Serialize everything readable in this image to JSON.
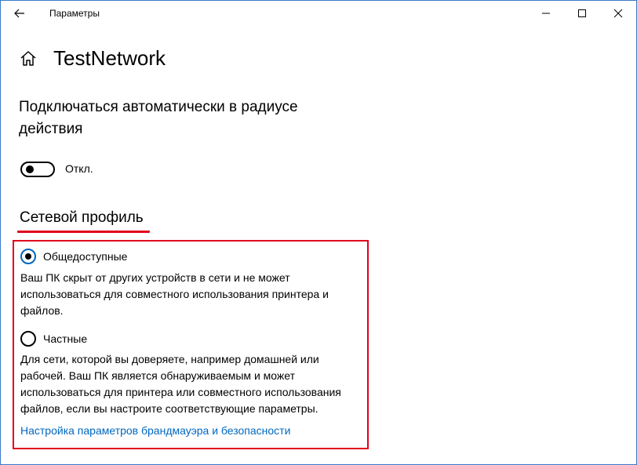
{
  "window": {
    "title": "Параметры"
  },
  "icons": {
    "back": "back-arrow-icon",
    "minimize": "minimize-icon",
    "maximize": "maximize-icon",
    "close": "close-icon",
    "home": "home-icon"
  },
  "page": {
    "title": "TestNetwork"
  },
  "auto_connect": {
    "heading": "Подключаться автоматически в радиусе действия",
    "toggle_state": "Откл."
  },
  "network_profile": {
    "heading": "Сетевой профиль",
    "options": [
      {
        "label": "Общедоступные",
        "selected": true,
        "description": "Ваш ПК скрыт от других устройств в сети и не может использоваться для совместного использования принтера и файлов."
      },
      {
        "label": "Частные",
        "selected": false,
        "description": "Для сети, которой вы доверяете, например домашней или рабочей. Ваш ПК является обнаруживаемым и может использоваться для принтера или совместного использования файлов, если вы настроите соответствующие параметры."
      }
    ],
    "firewall_link": "Настройка параметров брандмауэра и безопасности"
  },
  "colors": {
    "accent": "#0067c0",
    "highlight": "#e0001b",
    "window_border": "#3a78c9"
  }
}
